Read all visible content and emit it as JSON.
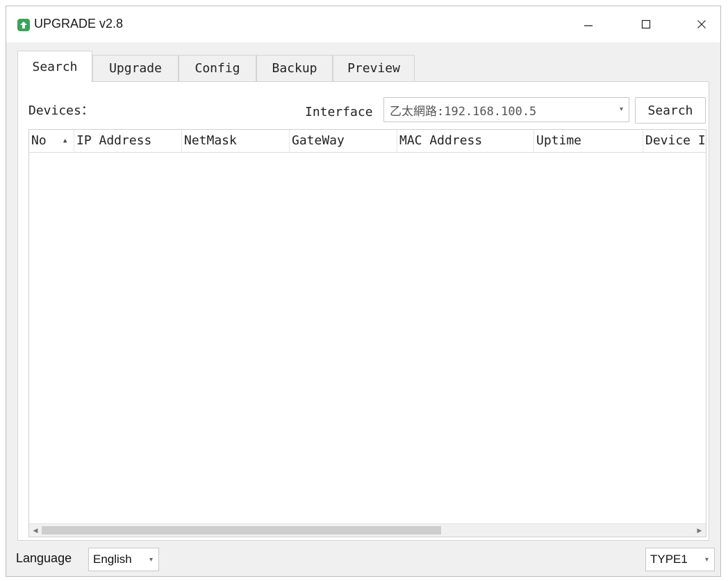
{
  "window": {
    "title": "UPGRADE v2.8",
    "controls": {
      "minimize": "—",
      "maximize": "☐",
      "close": "✕"
    }
  },
  "tabs": [
    {
      "label": "Search",
      "active": true
    },
    {
      "label": "Upgrade",
      "active": false
    },
    {
      "label": "Config",
      "active": false
    },
    {
      "label": "Backup",
      "active": false
    },
    {
      "label": "Preview",
      "active": false
    }
  ],
  "search_panel": {
    "devices_label": "Devices：",
    "interface_label": "Interface",
    "interface_value": "乙太網路:192.168.100.5",
    "search_button": "Search"
  },
  "device_table": {
    "columns": [
      "No",
      "IP Address",
      "NetMask",
      "GateWay",
      "MAC Address",
      "Uptime",
      "Device I"
    ],
    "sort_column": "No",
    "sort_direction": "ascending",
    "rows": []
  },
  "footer": {
    "language_label": "Language",
    "language_value": "English",
    "type_value": "TYPE1"
  },
  "icons": {
    "app": "upgrade-arrow-icon",
    "sort": "sort-ascending-icon",
    "dropdown": "chevron-down-icon",
    "scroll_left": "scroll-left-icon",
    "scroll_right": "scroll-right-icon"
  },
  "colors": {
    "app_icon": "#3aa35a",
    "window_bg": "#f0f0f0",
    "panel_bg": "#ffffff"
  }
}
